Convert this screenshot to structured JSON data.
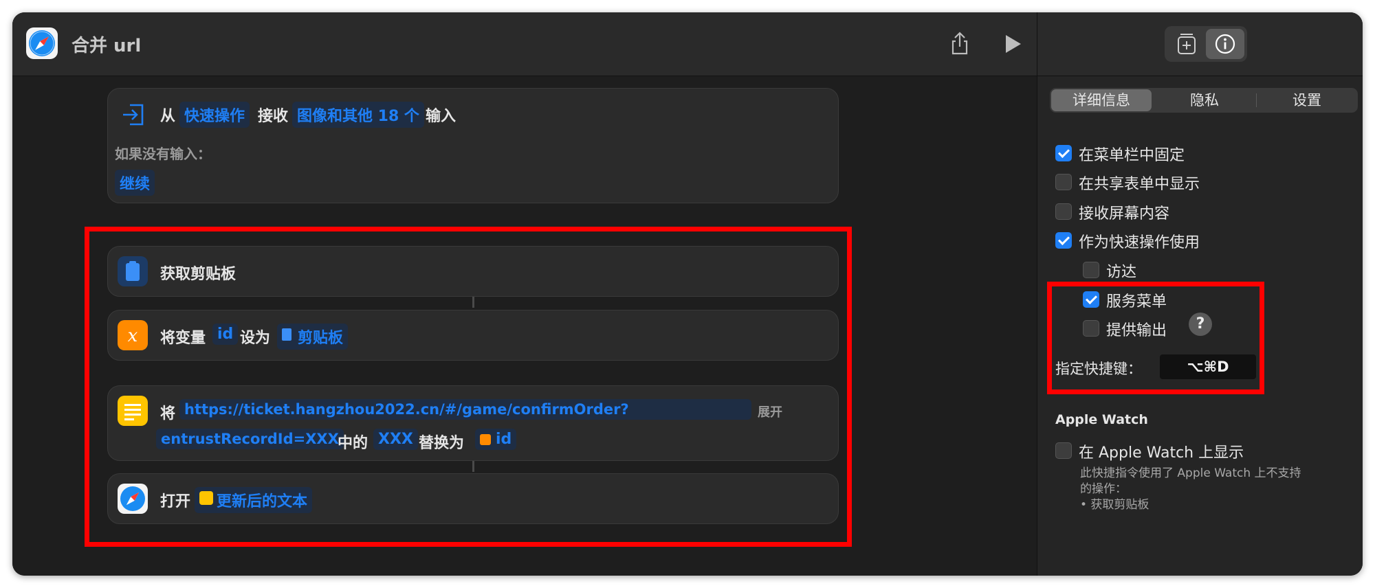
{
  "window": {
    "title": "合并 url"
  },
  "toolbar": {
    "share_icon": "share-icon",
    "run_icon": "play-icon"
  },
  "input_card": {
    "from": "从",
    "source": "快速操作",
    "receive": "接收",
    "types": "图像和其他 18 个",
    "input": "输入",
    "if_no_input": "如果没有输入：",
    "fallback": "继续"
  },
  "actions": [
    {
      "title": "获取剪贴板",
      "icon": "clipboard-icon"
    },
    {
      "prefix": "将变量",
      "variable": "id",
      "set_to": "设为",
      "value": "剪贴板",
      "icon": "variable-icon"
    },
    {
      "prefix": "将",
      "url_part1": "https://ticket.hangzhou2022.cn/#/game/confirmOrder?",
      "expand": "展开",
      "url_part2": "entrustRecordId=XXX",
      "in": "中的",
      "find": "XXX",
      "replace_with": "替换为",
      "replacement": "id",
      "icon": "text-icon"
    },
    {
      "prefix": "打开",
      "value": "更新后的文本",
      "icon": "safari-icon"
    }
  ],
  "inspector": {
    "tabs": [
      "详细信息",
      "隐私",
      "设置"
    ],
    "selected_tab": "详细信息",
    "options": [
      {
        "label": "在菜单栏中固定",
        "checked": true
      },
      {
        "label": "在共享表单中显示",
        "checked": false
      },
      {
        "label": "接收屏幕内容",
        "checked": false
      },
      {
        "label": "作为快速操作使用",
        "checked": true
      }
    ],
    "sub_options": [
      {
        "label": "访达",
        "checked": false
      },
      {
        "label": "服务菜单",
        "checked": true
      },
      {
        "label": "提供输出",
        "checked": false
      }
    ],
    "help": "?",
    "shortcut_label": "指定快捷键：",
    "shortcut_value": "⌥⌘D",
    "watch_title": "Apple Watch",
    "watch_option": "在 Apple Watch 上显示",
    "watch_note_1": "此快捷指令使用了 Apple Watch 上不支持",
    "watch_note_2": "的操作：",
    "watch_note_3": "• 获取剪贴板"
  },
  "colors": {
    "accent": "#1f7ff5",
    "highlight": "#ff0000",
    "background": "#1e1e1e"
  }
}
